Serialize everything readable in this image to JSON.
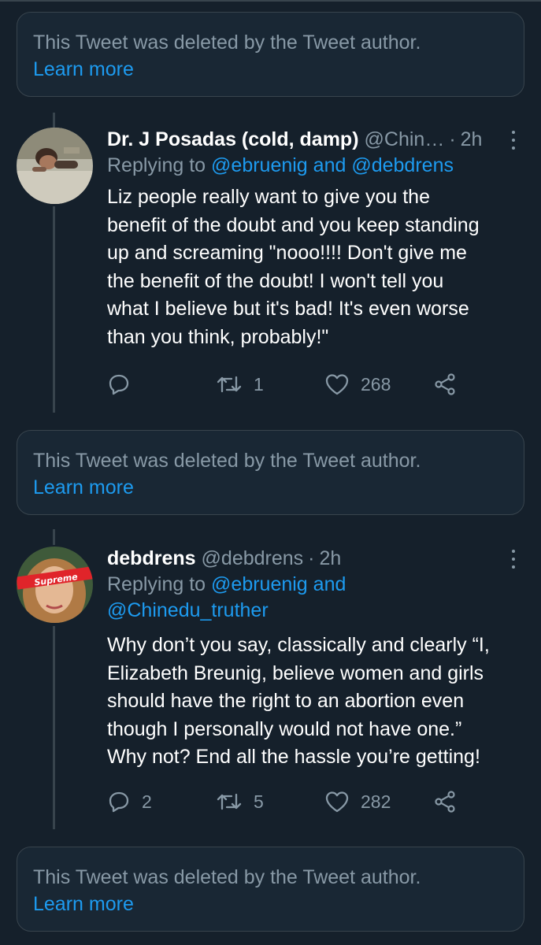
{
  "deleted_notice": {
    "text": "This Tweet was deleted by the Tweet author.",
    "link": "Learn more"
  },
  "tweets": [
    {
      "display_name": "Dr. J Posadas (cold, damp)",
      "handle": "@Chin…",
      "time": "2h",
      "replying_prefix": "Replying to",
      "mention_1": "@ebruenig",
      "replying_and": "and",
      "mention_2": "@debdrens",
      "text": "Liz people really want to give you the\nbenefit of the doubt and you keep standing\nup and screaming \"nooo!!!! Don't give me\nthe benefit of the doubt! I won't tell you\nwhat I believe but it's bad! It's even worse\nthan you think, probably!\"",
      "replies": "",
      "retweets": "1",
      "likes": "268"
    },
    {
      "display_name": "debdrens",
      "handle": "@debdrens",
      "time": "2h",
      "replying_prefix": "Replying to",
      "mention_1": "@ebruenig",
      "replying_and": "and",
      "mention_2": "@Chinedu_truther",
      "text": "Why don’t you say, classically and clearly “I,\nElizabeth Breunig, believe women and girls\nshould have the right to an abortion even\nthough I personally would not have one.”\nWhy not? End all the hassle you’re getting!",
      "replies": "2",
      "retweets": "5",
      "likes": "282",
      "avatar_badge": "Supreme"
    }
  ],
  "colors": {
    "background": "#15202b",
    "card": "#192734",
    "border": "#38444d",
    "muted": "#8899a6",
    "link": "#1d9bf0"
  }
}
